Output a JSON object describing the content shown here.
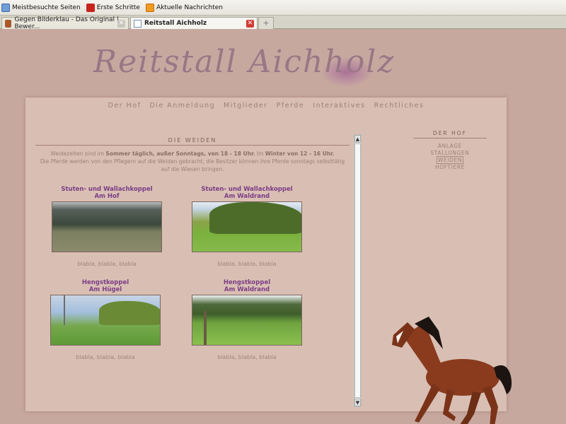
{
  "bookmarks": [
    "Meistbesuchte Seiten",
    "Erste Schritte",
    "Aktuelle Nachrichten"
  ],
  "tabs": [
    {
      "label": "Gegen Bilderklau - Das Original | Bewer..."
    },
    {
      "label": "Reitstall Aichholz"
    }
  ],
  "newtab_label": "+",
  "site": {
    "logo": "Reitstall Aichholz",
    "nav": [
      "Der Hof",
      "Die Anmeldung",
      "Mitglieder",
      "Pferde",
      "Interaktives",
      "Rechtliches"
    ]
  },
  "main": {
    "title": "DIE WEIDEN",
    "intro": {
      "p1": "Weidezeiten sind im ",
      "b1": "Sommer täglich, außer Sonntags, von 18 - 18 Uhr.",
      "p2": " Im ",
      "b2": "Winter von 12 - 16 Uhr.",
      "p3": "Die Pferde werden von den Pflegern auf die Weiden gebracht, die Besitzer können ihre Pferde sonntags selbsttätig auf die Wiesen bringen."
    },
    "cards": [
      {
        "line1": "Stuten- und Wallachkoppel",
        "line2": "Am Hof",
        "desc": "blabla, blabla, blabla"
      },
      {
        "line1": "Stuten- und Wallachkoppel",
        "line2": "Am Waldrand",
        "desc": "blabla, blabla, blabla"
      },
      {
        "line1": "Hengstkoppel",
        "line2": "Am Hügel",
        "desc": "blabla, blabla, blabla"
      },
      {
        "line1": "Hengstkoppel",
        "line2": "Am Waldrand",
        "desc": "blabla, blabla, blabla"
      }
    ]
  },
  "sidebar": {
    "title": "DER HOF",
    "items": [
      "ANLAGE",
      "STALLUNGEN",
      "WEIDEN",
      "HOFTIERE"
    ],
    "current": "WEIDEN"
  },
  "icons": {
    "bookmark_1": "page-icon",
    "bookmark_2": "red-bird-icon",
    "bookmark_3": "rss-icon",
    "close": "close-icon"
  }
}
